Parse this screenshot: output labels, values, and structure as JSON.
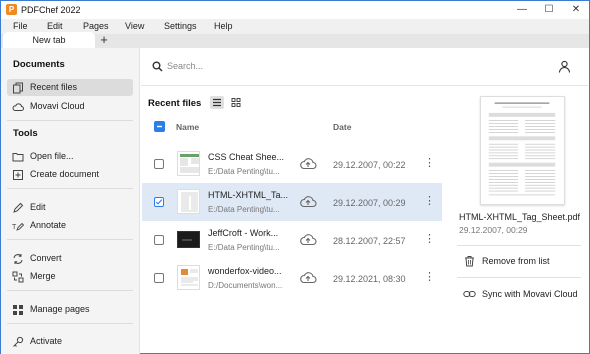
{
  "app": {
    "title": "PDFChef 2022",
    "icon": "pdfchef-logo-icon",
    "accent": "#2b7de9",
    "brand": "#f08a24"
  },
  "window_controls": {
    "minimize": "—",
    "maximize": "☐",
    "close": "✕"
  },
  "menu": [
    "File",
    "Edit",
    "Pages",
    "View",
    "Settings",
    "Help"
  ],
  "tabs": {
    "active": "New tab",
    "add": "+"
  },
  "sidebar": {
    "documents_title": "Documents",
    "documents": [
      {
        "label": "Recent files",
        "icon": "recent-files-icon",
        "active": true
      },
      {
        "label": "Movavi Cloud",
        "icon": "cloud-icon",
        "active": false
      }
    ],
    "tools_title": "Tools",
    "tools_open": [
      {
        "label": "Open file...",
        "icon": "folder-open-icon"
      },
      {
        "label": "Create document",
        "icon": "create-document-icon"
      }
    ],
    "tools_edit": [
      {
        "label": "Edit",
        "icon": "pencil-icon"
      },
      {
        "label": "Annotate",
        "icon": "annotate-icon"
      }
    ],
    "tools_convert": [
      {
        "label": "Convert",
        "icon": "convert-icon"
      },
      {
        "label": "Merge",
        "icon": "merge-icon"
      }
    ],
    "tools_pages": [
      {
        "label": "Manage pages",
        "icon": "grid-icon"
      }
    ],
    "tools_activate": [
      {
        "label": "Activate",
        "icon": "key-icon"
      }
    ]
  },
  "search": {
    "placeholder": "Search..."
  },
  "recent": {
    "title": "Recent files",
    "columns": {
      "name": "Name",
      "date": "Date"
    },
    "rows": [
      {
        "name": "CSS Cheat Shee...",
        "path": "E:/Data Penting\\tu...",
        "date": "29.12.2007, 00:22",
        "checked": false,
        "selected": false,
        "thumb": "css-cheat-sheet-thumbnail"
      },
      {
        "name": "HTML-XHTML_Ta...",
        "path": "E:/Data Penting\\tu...",
        "date": "29.12.2007, 00:29",
        "checked": true,
        "selected": true,
        "thumb": "html-xhtml-thumbnail"
      },
      {
        "name": "JeffCroft - Work...",
        "path": "E:/Data Penting\\tu...",
        "date": "28.12.2007, 22:57",
        "checked": false,
        "selected": false,
        "thumb": "jeffcroft-dark-thumbnail"
      },
      {
        "name": "wonderfox-video...",
        "path": "D:/Documents\\won...",
        "date": "29.12.2021, 08:30",
        "checked": false,
        "selected": false,
        "thumb": "wonderfox-thumbnail"
      }
    ]
  },
  "preview": {
    "file_name": "HTML-XHTML_Tag_Sheet.pdf",
    "date": "29.12.2007, 00:29",
    "actions": [
      {
        "label": "Remove from list",
        "icon": "trash-icon"
      },
      {
        "label": "Sync with Movavi Cloud",
        "icon": "sync-link-icon"
      }
    ]
  }
}
